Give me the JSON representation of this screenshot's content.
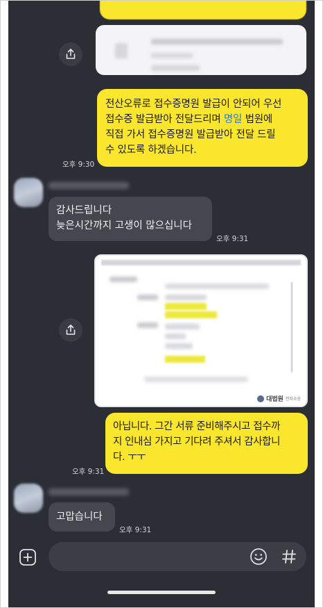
{
  "chat": {
    "msg_out_1": {
      "lines": [
        "전산오류로 접수증명원 발급이 안되어 우선",
        "접수증 발급받아 전달드리며 ",
        "직접 가서 접수증명원 발급받아 전달 드릴",
        "수 있도록 하겠습니다."
      ],
      "link_word": "명일",
      "line2_after": " 법원에",
      "time": "오후 9:30"
    },
    "msg_in_1": {
      "line1": "감사드립니다",
      "line2": "늦은시간까지 고생이 많으십니다",
      "time": "오후 9:31"
    },
    "doc_image": {
      "logo_text": "대법원",
      "logo_sub": "전자소송"
    },
    "msg_out_2": {
      "line1": "아닙니다. 그간 서류 준비해주시고 접수까",
      "line2": "지 인내심 가지고 기다려 주셔서 감사합니",
      "line3": "다. ㅜㅜ",
      "time": "오후 9:31"
    },
    "msg_in_2": {
      "text": "고맙습니다",
      "time": "오후 9:31"
    }
  },
  "input": {
    "placeholder": "",
    "add_icon": "plus-square-icon",
    "emoji_icon": "smile-icon",
    "hash_icon": "hash-icon"
  },
  "colors": {
    "background": "#2c2e35",
    "bubble_out": "#fae62d",
    "bubble_in": "#45474e",
    "link": "#2a7bd8"
  }
}
